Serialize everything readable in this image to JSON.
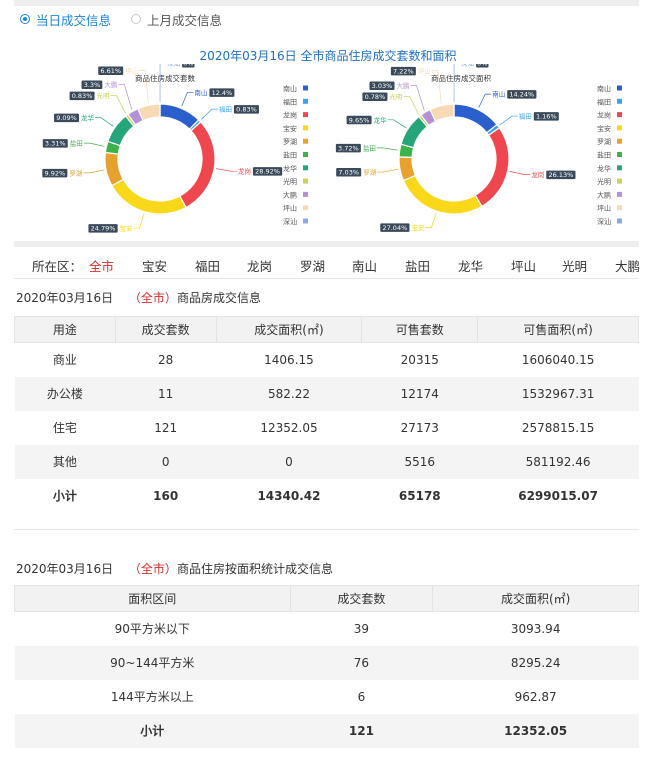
{
  "tabs": [
    {
      "label": "当日成交信息",
      "active": true
    },
    {
      "label": "上月成交信息",
      "active": false
    }
  ],
  "main_title": "2020年03月16日 全市商品住房成交套数和面积",
  "chart_data": [
    {
      "type": "pie",
      "title": "商品住房成交套数",
      "categories": [
        "南山",
        "福田",
        "龙岗",
        "宝安",
        "罗湖",
        "盐田",
        "龙华",
        "光明",
        "大鹏",
        "坪山",
        "深汕"
      ],
      "values": [
        12.4,
        0.83,
        28.92,
        24.79,
        9.92,
        3.31,
        9.09,
        0.83,
        3.3,
        6.61,
        0
      ],
      "labels": [
        "12.4%",
        "0.83%",
        "28.92%",
        "24.79%",
        "9.92%",
        "3.31%",
        "9.09%",
        "0.83%",
        "3.3%",
        "6.61%",
        "0%"
      ],
      "colors": [
        "#2b5fce",
        "#3aa3f0",
        "#f0474f",
        "#f9d81a",
        "#e6a12f",
        "#3cb24b",
        "#26a57a",
        "#ccd15a",
        "#b392d6",
        "#f8d9b5",
        "#8ba9e3"
      ]
    },
    {
      "type": "pie",
      "title": "商品住房成交面积",
      "categories": [
        "南山",
        "福田",
        "龙岗",
        "宝安",
        "罗湖",
        "盐田",
        "龙华",
        "光明",
        "大鹏",
        "坪山",
        "深汕"
      ],
      "values": [
        14.24,
        1.16,
        26.13,
        27.04,
        7.03,
        3.72,
        9.65,
        0.78,
        3.03,
        7.22,
        0
      ],
      "labels": [
        "14.24%",
        "1.16%",
        "26.13%",
        "27.04%",
        "7.03%",
        "3.72%",
        "9.65%",
        "0.78%",
        "3.03%",
        "7.22%",
        "0%"
      ],
      "colors": [
        "#2b5fce",
        "#3aa3f0",
        "#f0474f",
        "#f9d81a",
        "#e6a12f",
        "#3cb24b",
        "#26a57a",
        "#ccd15a",
        "#b392d6",
        "#f8d9b5",
        "#8ba9e3"
      ]
    }
  ],
  "district_filter": {
    "label": "所在区：",
    "items": [
      "全市",
      "宝安",
      "福田",
      "龙岗",
      "罗湖",
      "南山",
      "盐田",
      "龙华",
      "坪山",
      "光明",
      "大鹏"
    ],
    "active": "全市"
  },
  "section1": {
    "date": "2020年03月16日",
    "region": "（全市）",
    "suffix": "商品房成交信息",
    "headers": [
      "用途",
      "成交套数",
      "成交面积(㎡)",
      "可售套数",
      "可售面积(㎡)"
    ],
    "rows": [
      [
        "商业",
        "28",
        "1406.15",
        "20315",
        "1606040.15"
      ],
      [
        "办公楼",
        "11",
        "582.22",
        "12174",
        "1532967.31"
      ],
      [
        "住宅",
        "121",
        "12352.05",
        "27173",
        "2578815.15"
      ],
      [
        "其他",
        "0",
        "0",
        "5516",
        "581192.46"
      ],
      [
        "小计",
        "160",
        "14340.42",
        "65178",
        "6299015.07"
      ]
    ]
  },
  "section2": {
    "date": "2020年03月16日",
    "region": "（全市）",
    "suffix": "商品住房按面积统计成交信息",
    "headers": [
      "面积区间",
      "成交套数",
      "成交面积(㎡)"
    ],
    "rows": [
      [
        "90平方米以下",
        "39",
        "3093.94"
      ],
      [
        "90~144平方米",
        "76",
        "8295.24"
      ],
      [
        "144平方米以上",
        "6",
        "962.87"
      ],
      [
        "小计",
        "121",
        "12352.05"
      ]
    ]
  }
}
